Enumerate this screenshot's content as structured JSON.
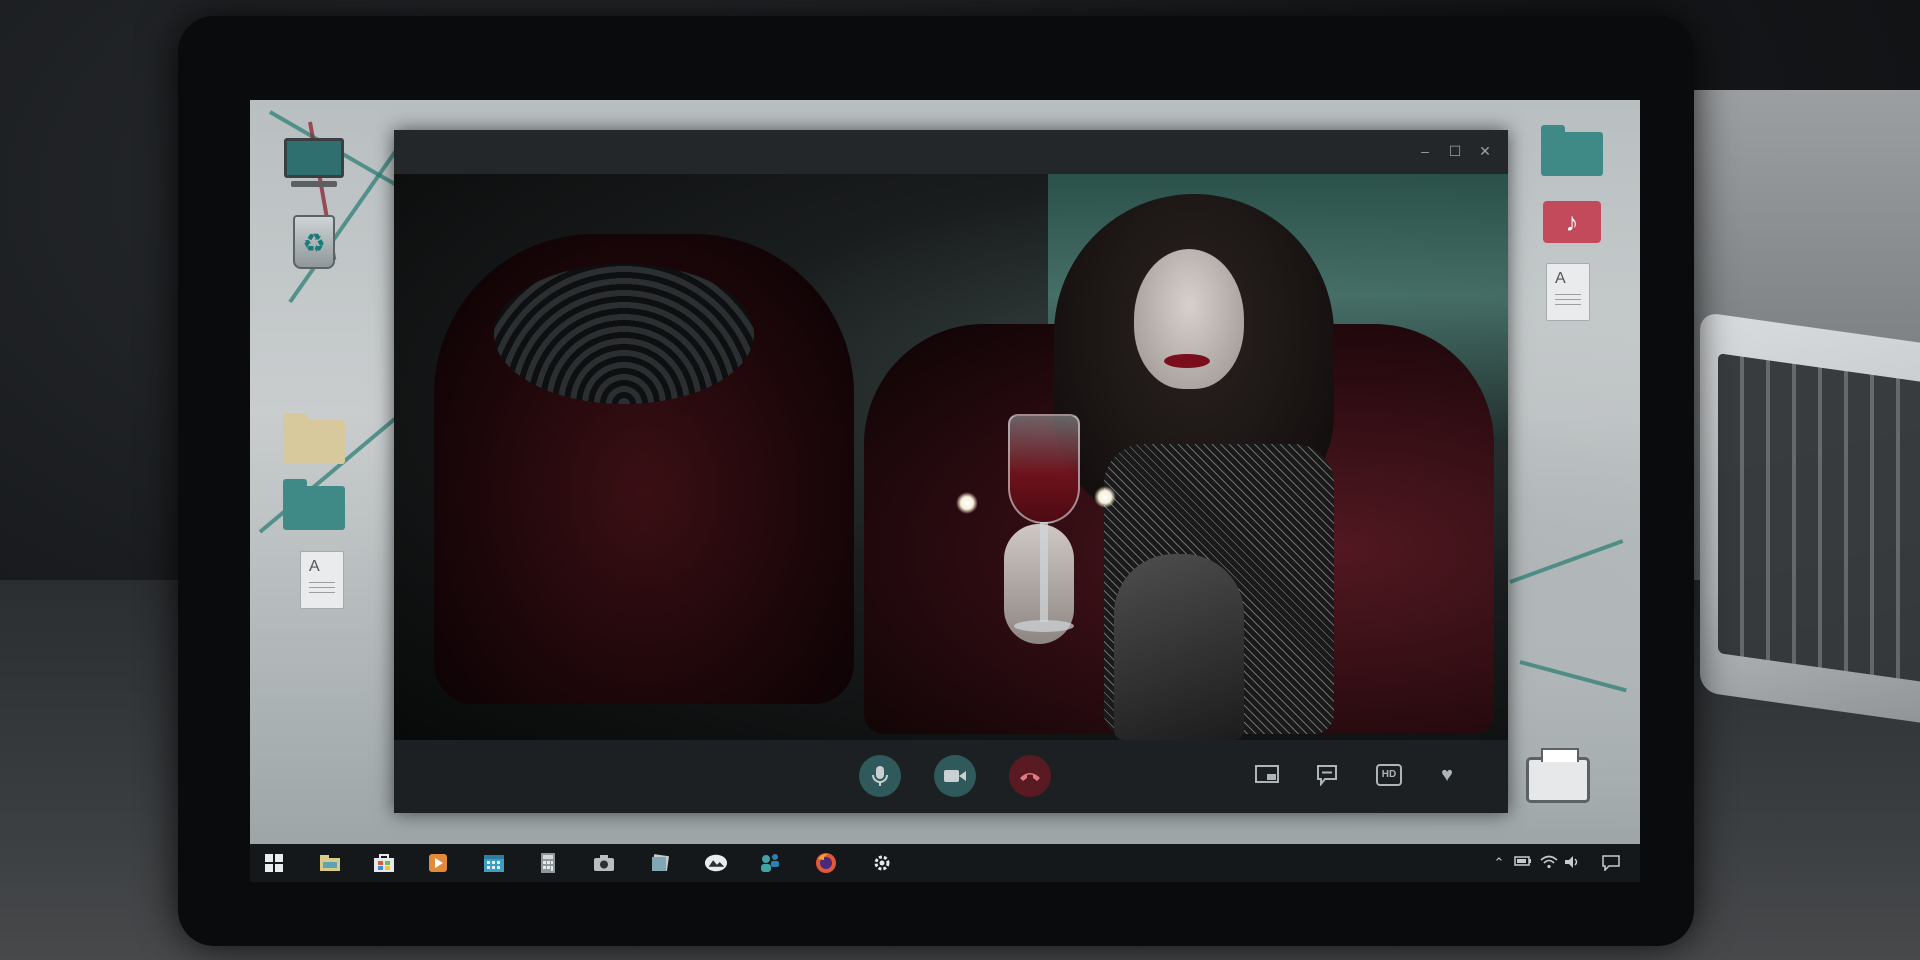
{
  "taskbar": {
    "pinned_apps": [
      "windows-start-icon",
      "file-explorer-icon",
      "store-icon",
      "media-player-icon",
      "calendar-icon",
      "calculator-icon",
      "camera-icon",
      "photos-icon",
      "mail-icon",
      "people-icon",
      "firefox-icon",
      "settings-icon"
    ],
    "tray": [
      "chevron-up-icon",
      "battery-icon",
      "wifi-icon",
      "volume-icon",
      "notification-icon"
    ]
  },
  "desktop_icons_left": [
    "computer-icon",
    "recycle-bin-icon",
    "folder-icon",
    "teal-folder-icon",
    "text-document-icon"
  ],
  "desktop_icons_right": [
    "teal-folder-icon",
    "music-folder-icon",
    "text-document-icon",
    "printer-icon"
  ],
  "document_icon_letter": "A",
  "call_controls": {
    "buttons": [
      "microphone-icon",
      "video-camera-icon",
      "hang-up-icon"
    ],
    "options": [
      "picture-in-picture-icon",
      "chat-icon",
      "hd-icon",
      "heart-icon"
    ],
    "hd_label": "HD"
  },
  "colors": {
    "accent_teal": "#30595b",
    "hang_up_red": "#5a1a22",
    "taskbar": "#15181a",
    "call_window": "#1f2224"
  }
}
